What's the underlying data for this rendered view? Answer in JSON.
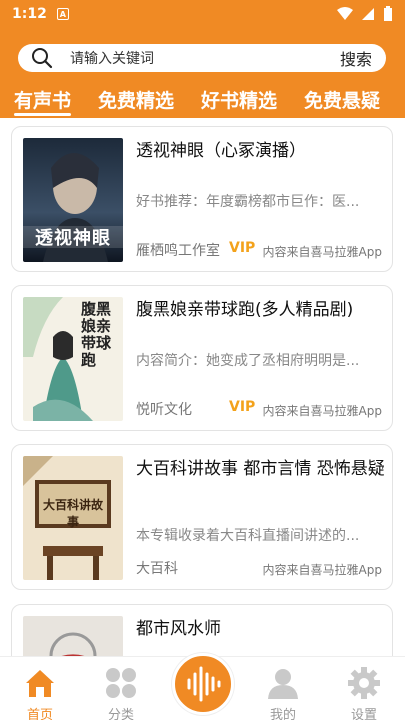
{
  "status_bar": {
    "time": "1:12",
    "badge": "A"
  },
  "search": {
    "placeholder": "请输入关键词",
    "button_label": "搜索"
  },
  "tabs": [
    "有声书",
    "免费精选",
    "好书精选",
    "免费悬疑"
  ],
  "books": [
    {
      "title": "透视神眼（心冢演播）",
      "description": "好书推荐：年度霸榜都市巨作：医...",
      "author": "雁栖鸣工作室",
      "vip": "VIP",
      "source": "内容来自喜马拉雅App",
      "cover_text": "透视神眼"
    },
    {
      "title": "腹黑娘亲带球跑(多人精品剧)",
      "description": "内容简介：她变成了丞相府明明是...",
      "author": "悦听文化",
      "vip": "VIP",
      "source": "内容来自喜马拉雅App",
      "cover_text": "腹黑娘亲带球跑"
    },
    {
      "title": "大百科讲故事 都市言情 恐怖悬疑",
      "description": "本专辑收录着大百科直播间讲述的...",
      "author": "大百科",
      "vip": "",
      "source": "内容来自喜马拉雅App",
      "cover_text": "大百科讲故事"
    },
    {
      "title": "都市风水师",
      "description": "",
      "author": "",
      "vip": "",
      "source": "",
      "cover_text": ""
    }
  ],
  "nav": {
    "home": "首页",
    "category": "分类",
    "mine": "我的",
    "settings": "设置"
  },
  "colors": {
    "brand": "#f08a24",
    "vip": "#f3a21b"
  }
}
